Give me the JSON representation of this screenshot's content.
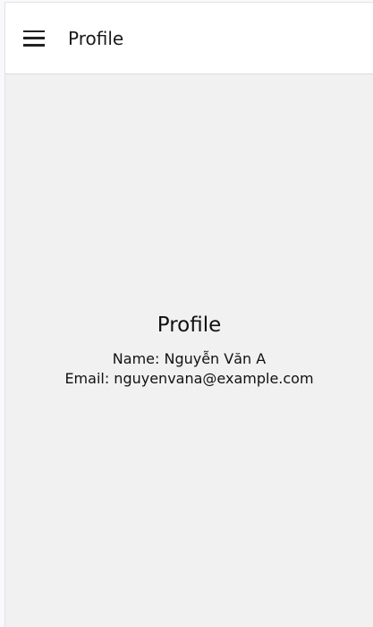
{
  "header": {
    "title": "Profile"
  },
  "main": {
    "heading": "Profile",
    "name_line": "Name: Nguyễn Văn A",
    "email_line": "Email: nguyenvana@example.com"
  }
}
